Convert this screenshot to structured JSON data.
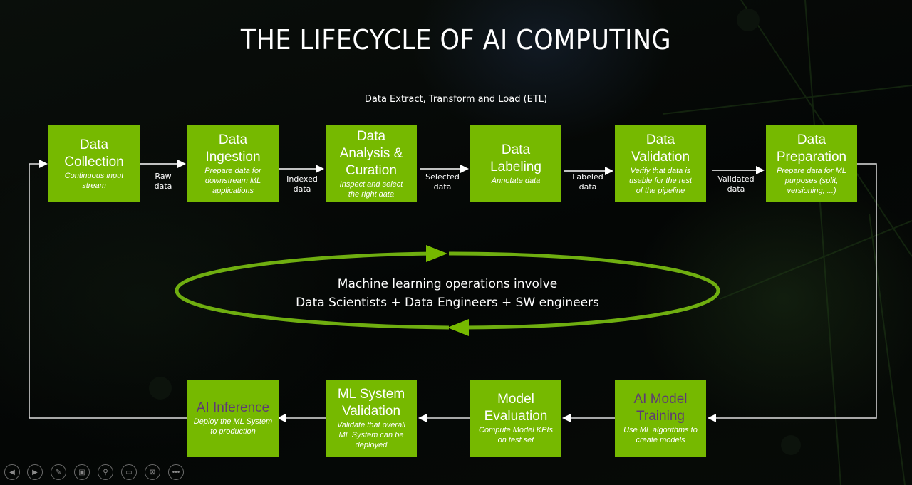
{
  "title": "THE LIFECYCLE OF AI COMPUTING",
  "subtitle": "Data Extract, Transform and Load (ETL)",
  "colors": {
    "box": "#76b900",
    "purple_text": "#5e3b74",
    "loop": "#76b900",
    "connector": "#ffffff"
  },
  "top_row": [
    {
      "title": "Data\nCollection",
      "desc": "Continuous input\nstream"
    },
    {
      "title": "Data\nIngestion",
      "desc": "Prepare data for\ndownstream ML\napplications"
    },
    {
      "title": "Data\nAnalysis &\nCuration",
      "desc": "Inspect and select\nthe right data"
    },
    {
      "title": "Data\nLabeling",
      "desc": "Annotate data"
    },
    {
      "title": "Data\nValidation",
      "desc": "Verify that data is\nusable for the rest\nof the pipeline"
    },
    {
      "title": "Data\nPreparation",
      "desc": "Prepare data for ML\npurposes (split,\nversioning, ...)"
    }
  ],
  "top_connectors": [
    "Raw\ndata",
    "Indexed\ndata",
    "Selected\ndata",
    "Labeled\ndata",
    "Validated\ndata"
  ],
  "bottom_row": [
    {
      "title": "AI Inference",
      "desc": "Deploy the ML System\nto production",
      "purple": true
    },
    {
      "title": "ML System\nValidation",
      "desc": "Validate that overall\nML System can be\ndeployed",
      "purple": false
    },
    {
      "title": "Model\nEvaluation",
      "desc": "Compute Model KPIs\non test set",
      "purple": false
    },
    {
      "title": "AI Model\nTraining",
      "desc": "Use ML algorithms to\ncreate models",
      "purple": true
    }
  ],
  "loop": {
    "line1": "Machine learning operations involve",
    "line2": "Data Scientists + Data Engineers + SW engineers"
  },
  "controls": [
    {
      "name": "previous-slide",
      "glyph": "◀"
    },
    {
      "name": "next-slide",
      "glyph": "▶"
    },
    {
      "name": "pen",
      "glyph": "✎"
    },
    {
      "name": "see-all-slides",
      "glyph": "▣"
    },
    {
      "name": "zoom",
      "glyph": "⚲"
    },
    {
      "name": "subtitles",
      "glyph": "▭"
    },
    {
      "name": "camera-off",
      "glyph": "⊠"
    },
    {
      "name": "more-options",
      "glyph": "•••"
    }
  ]
}
